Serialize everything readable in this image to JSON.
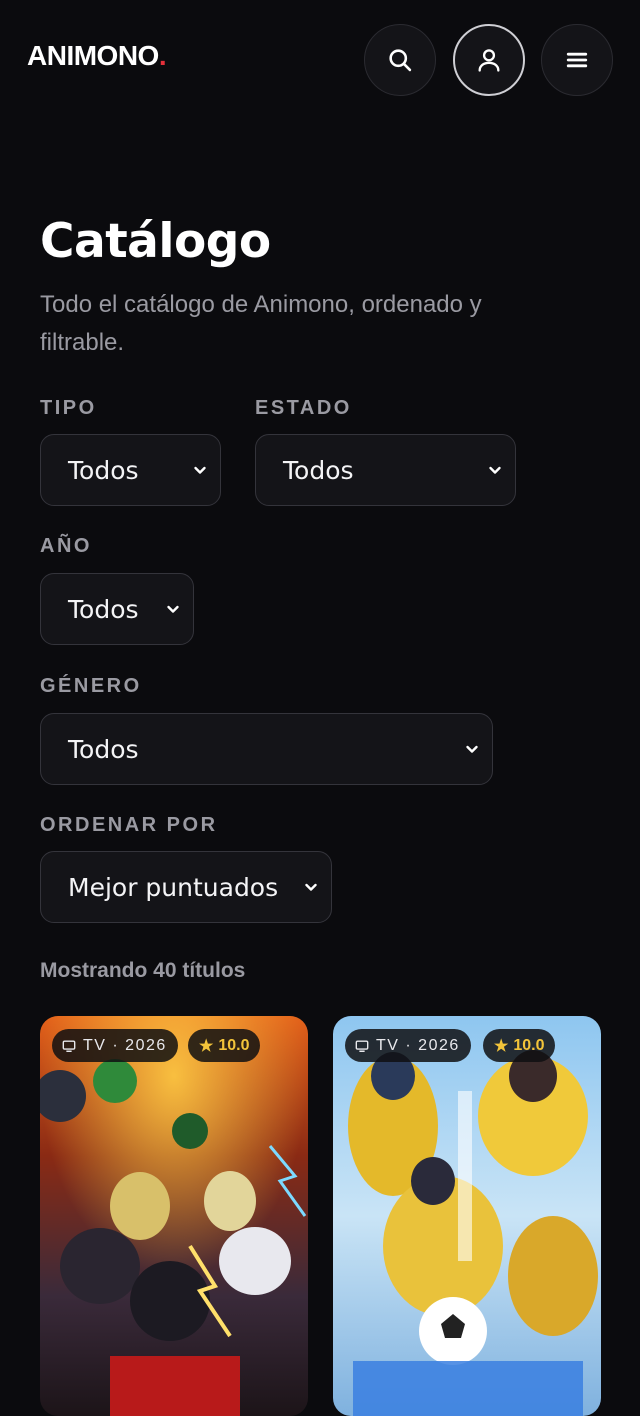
{
  "header": {
    "logo": "ANIMONO",
    "logo_dot": ".",
    "buttons": [
      "search-icon",
      "user-icon",
      "menu-icon"
    ]
  },
  "page": {
    "title": "Catálogo",
    "subtitle": "Todo el catálogo de Animono, ordenado y filtrable."
  },
  "filters": {
    "tipo": {
      "label": "TIPO",
      "value": "Todos"
    },
    "estado": {
      "label": "ESTADO",
      "value": "Todos"
    },
    "anio": {
      "label": "AÑO",
      "value": "Todos"
    },
    "genero": {
      "label": "GÉNERO",
      "value": "Todos"
    },
    "orden": {
      "label": "ORDENAR POR",
      "value": "Mejor puntuados"
    }
  },
  "results": {
    "count_text": "Mostrando 40 títulos",
    "cards": [
      {
        "type": "TV",
        "year": "2026",
        "type_year": "TV · 2026",
        "rating": "10.0",
        "star": "★"
      },
      {
        "type": "TV",
        "year": "2026",
        "type_year": "TV · 2026",
        "rating": "10.0",
        "star": "★"
      }
    ]
  },
  "colors": {
    "background": "#0b0b0e",
    "accent_dot": "#e5303a",
    "rating": "#f3c43a"
  }
}
